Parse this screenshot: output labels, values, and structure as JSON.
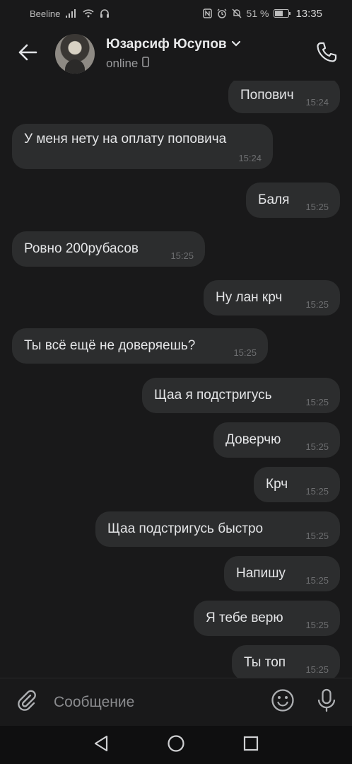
{
  "status_bar": {
    "carrier": "Beeline",
    "battery": "51 %",
    "time": "13:35"
  },
  "header": {
    "contact_name": "Юзарсиф Юсупов",
    "contact_status": "online"
  },
  "messages": [
    {
      "dir": "out",
      "text": "Попович",
      "time": "15:24"
    },
    {
      "dir": "in",
      "text": "У меня нету на оплату поповича",
      "time": "15:24"
    },
    {
      "dir": "out",
      "text": "Баля",
      "time": "15:25"
    },
    {
      "dir": "in",
      "text": "Ровно 200рубасов",
      "time": "15:25"
    },
    {
      "dir": "out",
      "text": "Ну лан крч",
      "time": "15:25"
    },
    {
      "dir": "in",
      "text": "Ты всё ещё не доверяешь?",
      "time": "15:25"
    },
    {
      "dir": "out",
      "text": "Щаа я подстригусь",
      "time": "15:25"
    },
    {
      "dir": "out",
      "text": "Доверчю",
      "time": "15:25"
    },
    {
      "dir": "out",
      "text": "Крч",
      "time": "15:25"
    },
    {
      "dir": "out",
      "text": "Щаа подстригусь быстро",
      "time": "15:25"
    },
    {
      "dir": "out",
      "text": "Напишу",
      "time": "15:25"
    },
    {
      "dir": "out",
      "text": "Я тебе верю",
      "time": "15:25"
    },
    {
      "dir": "out",
      "text": "Ты топ",
      "time": "15:25"
    }
  ],
  "composer": {
    "placeholder": "Сообщение"
  },
  "icons": {
    "back": "arrow-left-icon",
    "call": "phone-icon",
    "attach": "paperclip-icon",
    "emoji": "smile-icon",
    "mic": "microphone-icon",
    "nav_back": "triangle-back-icon",
    "nav_home": "circle-home-icon",
    "nav_recents": "square-recents-icon"
  },
  "colors": {
    "background": "#19191a",
    "bubble": "#2c2d2e",
    "text": "#e4e5e7",
    "muted": "#6d6e70"
  }
}
